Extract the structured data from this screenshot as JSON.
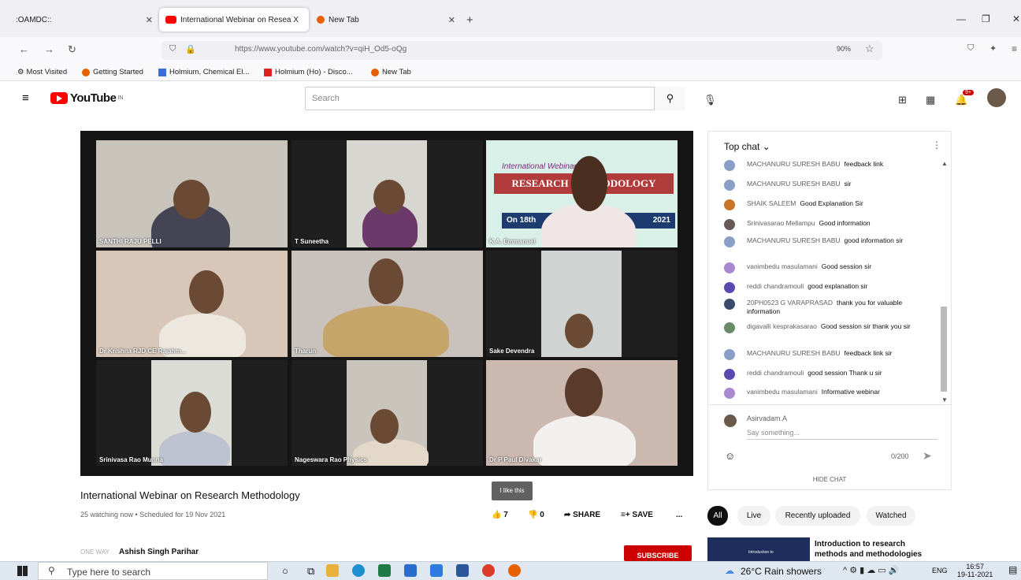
{
  "browser": {
    "tabs": [
      {
        "label": ":OAMDC::"
      },
      {
        "label": "International Webinar on Resea X"
      },
      {
        "label": "New Tab"
      }
    ],
    "url": "https://www.youtube.com/watch?v=qiH_Od5-oQg",
    "zoom": "90%",
    "bookmarks": [
      "Most Visited",
      "Getting Started",
      "Holmium, Chemical El...",
      "Holmium (Ho) - Disco...",
      "New Tab"
    ]
  },
  "youtube": {
    "logo_text": "YouTube",
    "country": "IN",
    "search_placeholder": "Search",
    "notifications": "9+"
  },
  "video": {
    "title": "International Webinar on Research Methodology",
    "meta": "25 watching now • Scheduled for 19 Nov 2021",
    "tooltip": "I like this",
    "likes": "7",
    "dislikes": "0",
    "share": "SHARE",
    "save": "SAVE",
    "more": "...",
    "channel_logo": "ONE WAY",
    "channel": "Ashish Singh Parihar",
    "subscribe": "SUBSCRIBE",
    "participants": [
      "SANTHI RAJU PELLI",
      "T Suneetha",
      "K.A. Emmanuel",
      "Dr Krishna RJD CE Rajahm...",
      "Tharun",
      "Sake Devendra",
      "Srinivasa Rao Munna",
      "Nageswara Rao Physics",
      "Dr P Paul Divakar"
    ],
    "slide": {
      "line1": "International Webinar on",
      "line2": "RESEARCH METHODOLOGY",
      "line3": "On 18th",
      "line4": "2021"
    }
  },
  "chat": {
    "header": "Top chat",
    "messages": [
      {
        "author": "MACHANURU SURESH BABU",
        "text": "feedback link"
      },
      {
        "author": "MACHANURU SURESH BABU",
        "text": "sir"
      },
      {
        "author": "SHAIK SALEEM",
        "text": "Good Explanation Sir"
      },
      {
        "author": "Srinivasarao Mellampu",
        "text": "Good information"
      },
      {
        "author": "MACHANURU SURESH BABU",
        "text": "good information sir"
      },
      {
        "author": "vanimbedu masulamani",
        "text": "Good session sir"
      },
      {
        "author": "reddi chandramouli",
        "text": "good explanation sir"
      },
      {
        "author": "20PH0523 G VARAPRASAD",
        "text": "thank you for valuable information"
      },
      {
        "author": "digavalli kesprakasarao",
        "text": "Good session sir thank you sir"
      },
      {
        "author": "MACHANURU SURESH BABU",
        "text": "feedback link sir"
      },
      {
        "author": "reddi chandramouli",
        "text": "good session Thank u sir"
      },
      {
        "author": "vanimbedu masulamani",
        "text": "Informative webinar"
      }
    ],
    "user": "Asirvadam.A",
    "input_placeholder": "Say something...",
    "counter": "0/200",
    "hide": "HIDE CHAT"
  },
  "chips": [
    "All",
    "Live",
    "Recently uploaded",
    "Watched"
  ],
  "recommendation": {
    "title": "Introduction to research methods and methodologies",
    "thumb_text": "Introduction to"
  },
  "taskbar": {
    "search": "Type here to search",
    "weather": "26°C  Rain showers",
    "lang": "ENG",
    "time": "16:57",
    "date": "19-11-2021"
  }
}
